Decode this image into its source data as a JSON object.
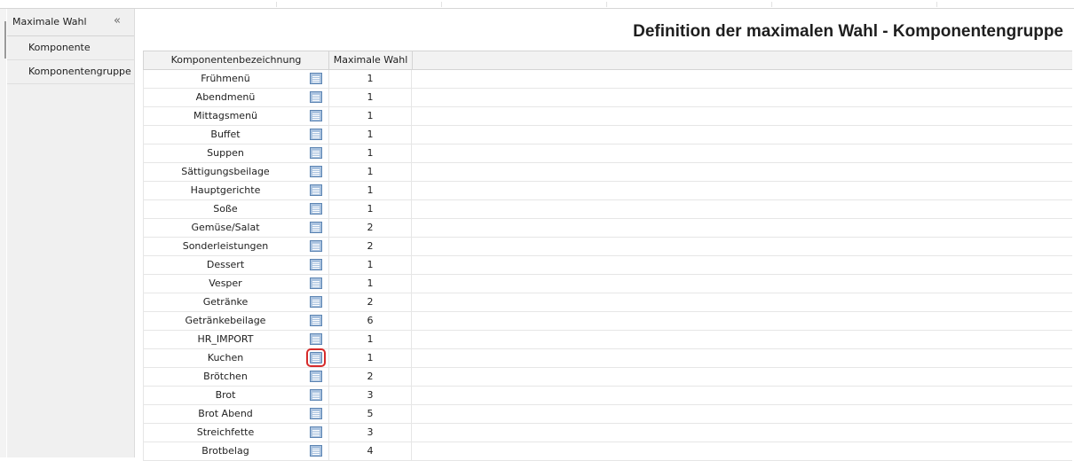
{
  "sidebar": {
    "title": "Maximale Wahl",
    "collapse_label": "«",
    "items": [
      {
        "label": "Komponente"
      },
      {
        "label": "Komponentengruppe"
      }
    ]
  },
  "main": {
    "title": "Definition der maximalen Wahl - Komponentengruppe"
  },
  "table": {
    "columns": [
      "Komponentenbezeichnung",
      "Maximale Wahl"
    ],
    "highlighted_row": 15,
    "rows": [
      {
        "name": "Frühmenü",
        "value": "1"
      },
      {
        "name": "Abendmenü",
        "value": "1"
      },
      {
        "name": "Mittagsmenü",
        "value": "1"
      },
      {
        "name": "Buffet",
        "value": "1"
      },
      {
        "name": "Suppen",
        "value": "1"
      },
      {
        "name": "Sättigungsbeilage",
        "value": "1"
      },
      {
        "name": "Hauptgerichte",
        "value": "1"
      },
      {
        "name": "Soße",
        "value": "1"
      },
      {
        "name": "Gemüse/Salat",
        "value": "2"
      },
      {
        "name": "Sonderleistungen",
        "value": "2"
      },
      {
        "name": "Dessert",
        "value": "1"
      },
      {
        "name": "Vesper",
        "value": "1"
      },
      {
        "name": "Getränke",
        "value": "2"
      },
      {
        "name": "Getränkebeilage",
        "value": "6"
      },
      {
        "name": "HR_IMPORT",
        "value": "1"
      },
      {
        "name": "Kuchen",
        "value": "1"
      },
      {
        "name": "Brötchen",
        "value": "2"
      },
      {
        "name": "Brot",
        "value": "3"
      },
      {
        "name": "Brot Abend",
        "value": "5"
      },
      {
        "name": "Streichfette",
        "value": "3"
      },
      {
        "name": "Brotbelag",
        "value": "4"
      }
    ]
  },
  "colors": {
    "highlight": "#d62b2b",
    "icon_fill": "#a9c2df",
    "icon_border": "#5d85b3"
  }
}
